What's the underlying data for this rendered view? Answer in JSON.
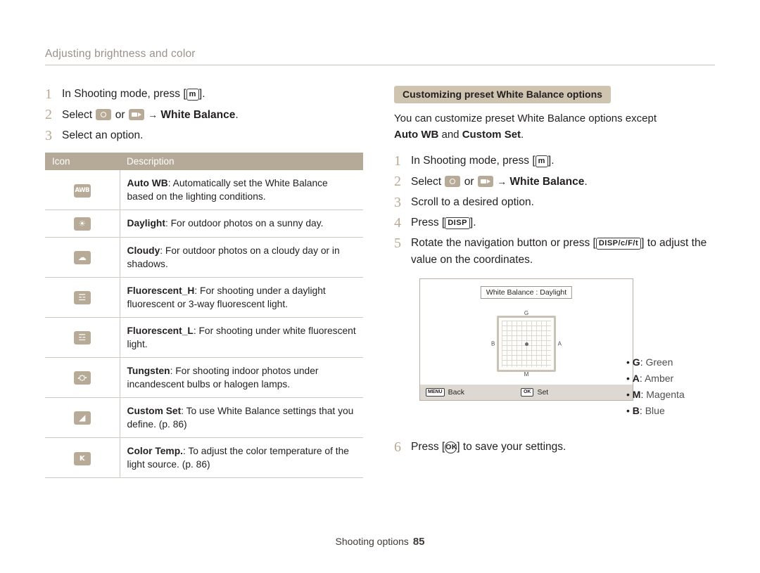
{
  "header": {
    "title": "Adjusting brightness and color"
  },
  "left": {
    "steps": [
      {
        "num": "1",
        "text_before": "In Shooting mode, press [",
        "key": "m",
        "text_after": "]."
      },
      {
        "num": "2",
        "text_before": "Select ",
        "or": " or ",
        "arrow": "→",
        "bold": "White Balance",
        "text_after": "."
      },
      {
        "num": "3",
        "text": "Select an option."
      }
    ],
    "table": {
      "headers": [
        "Icon",
        "Description"
      ],
      "rows": [
        {
          "icon": "auto-wb-icon",
          "icon_text": "AWB",
          "term": "Auto WB",
          "desc": ": Automatically set the White Balance based on the lighting conditions."
        },
        {
          "icon": "daylight-icon",
          "icon_text": "☀",
          "term": "Daylight",
          "desc": ": For outdoor photos on a sunny day."
        },
        {
          "icon": "cloudy-icon",
          "icon_text": "☁",
          "term": "Cloudy",
          "desc": ": For outdoor photos on a cloudy day or in shadows."
        },
        {
          "icon": "fluorescent-h-icon",
          "icon_text": "☲",
          "term": "Fluorescent_H",
          "desc": ": For shooting under a daylight fluorescent or 3-way fluorescent light."
        },
        {
          "icon": "fluorescent-l-icon",
          "icon_text": "☲",
          "term": "Fluorescent_L",
          "desc": ": For shooting under white fluorescent light."
        },
        {
          "icon": "tungsten-icon",
          "icon_text": "⛮",
          "term": "Tungsten",
          "desc": ": For shooting indoor photos under incandescent bulbs or halogen lamps."
        },
        {
          "icon": "custom-set-icon",
          "icon_text": "◢",
          "term": "Custom Set",
          "desc": ": To use White Balance settings that you define. (p. 86)"
        },
        {
          "icon": "color-temp-icon",
          "icon_text": "K",
          "term": "Color Temp.",
          "desc": ": To adjust the color temperature of the light source. (p. 86)"
        }
      ]
    }
  },
  "right": {
    "section_title": "Customizing preset White Balance options",
    "intro_line1": "You can customize preset White Balance options except",
    "intro_bold1": "Auto WB",
    "intro_mid": " and ",
    "intro_bold2": "Custom Set",
    "intro_end": ".",
    "steps": [
      {
        "num": "1",
        "text_before": "In Shooting mode, press [",
        "key": "m",
        "text_after": "]."
      },
      {
        "num": "2",
        "text_before": "Select ",
        "or": " or ",
        "arrow": "→",
        "bold": "White Balance",
        "text_after": "."
      },
      {
        "num": "3",
        "text": "Scroll to a desired option."
      },
      {
        "num": "4",
        "text_before": "Press [",
        "key": "DISP",
        "text_after": "]."
      },
      {
        "num": "5",
        "text_before": "Rotate the navigation button or press [",
        "keys": "DISP/c/F/t",
        "text_after": "] to adjust the value on the coordinates."
      },
      {
        "num": "6",
        "text_before": "Press [",
        "key": "OK",
        "text_after": "] to save your settings."
      }
    ],
    "lcd": {
      "title": "White Balance : Daylight",
      "coord_labels": {
        "top": "G",
        "bottom": "M",
        "left": "B",
        "right": "A"
      },
      "back_key": "MENU",
      "back_label": "Back",
      "set_key": "OK",
      "set_label": "Set"
    },
    "legend": [
      {
        "letter": "G",
        "word": "Green"
      },
      {
        "letter": "A",
        "word": "Amber"
      },
      {
        "letter": "M",
        "word": "Magenta"
      },
      {
        "letter": "B",
        "word": "Blue"
      }
    ]
  },
  "footer": {
    "label": "Shooting options",
    "page": "85"
  },
  "colors": {
    "header_text": "#9b9188",
    "step_number": "#b9a992",
    "table_header_bg": "#b5aa98",
    "pill_bg": "#cfc4b0",
    "icon_badge": "#b7aa97"
  }
}
